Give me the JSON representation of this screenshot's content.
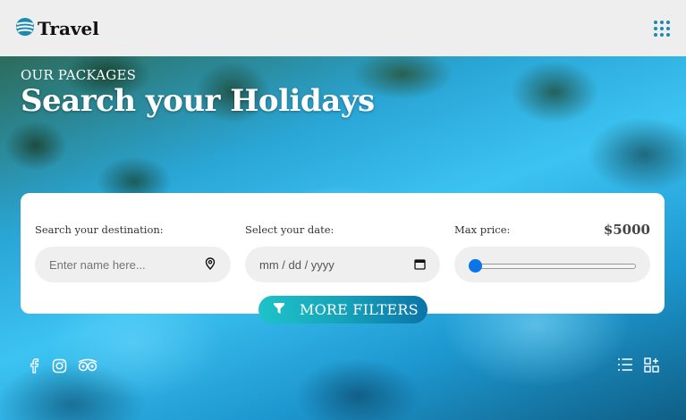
{
  "header": {
    "brand": "Travel",
    "logo_icon": "globe-icon",
    "menu_icon": "grid-dots-icon"
  },
  "hero": {
    "subtitle": "OUR PACKAGES",
    "title": "Search your Holidays"
  },
  "search": {
    "destination_label": "Search your destination:",
    "destination_placeholder": "Enter name here...",
    "destination_value": "",
    "date_label": "Select your date:",
    "date_placeholder": "mm / dd / yyyy",
    "price_label": "Max price:",
    "price_value": "$5000",
    "price_slider_fraction": 0.0
  },
  "filters_button": {
    "label": "MORE FILTERS",
    "icon": "filter-icon"
  },
  "social": [
    "facebook-icon",
    "instagram-icon",
    "tripadvisor-icon"
  ],
  "view_icons": [
    "list-view-icon",
    "grid-add-icon"
  ],
  "colors": {
    "header_bg": "#eeeeee",
    "accent": "#1a8ab0",
    "slider_thumb": "#0a74e8",
    "button_gradient_start": "#1ec3c9",
    "button_gradient_end": "#0b74a8"
  }
}
